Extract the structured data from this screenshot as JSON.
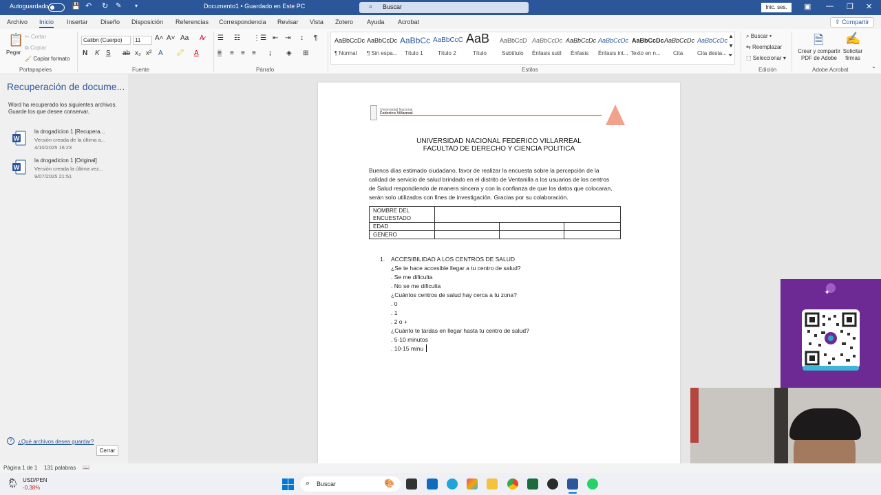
{
  "titlebar": {
    "autosave_label": "Autoguardado",
    "doc_title": "Documento1 • Guardado en Este PC",
    "search_placeholder": "Buscar",
    "signin_label": "Inic. ses."
  },
  "menu": {
    "tabs": [
      "Archivo",
      "Inicio",
      "Insertar",
      "Diseño",
      "Disposición",
      "Referencias",
      "Correspondencia",
      "Revisar",
      "Vista",
      "Zotero",
      "Ayuda",
      "Acrobat"
    ],
    "active_tab": "Inicio",
    "share_label": "Compartir"
  },
  "ribbon": {
    "clipboard": {
      "paste": "Pegar",
      "cut": "Cortar",
      "copy": "Copiar",
      "format_painter": "Copiar formato",
      "group": "Portapapeles"
    },
    "font": {
      "name": "Calibri (Cuerpo)",
      "size": "11",
      "group": "Fuente"
    },
    "paragraph": {
      "group": "Párrafo"
    },
    "styles": {
      "group": "Estilos",
      "items": [
        {
          "sample": "AaBbCcDc",
          "name": "¶ Normal"
        },
        {
          "sample": "AaBbCcDc",
          "name": "¶ Sin espa..."
        },
        {
          "sample": "AaBbCc",
          "name": "Título 1"
        },
        {
          "sample": "AaBbCcC",
          "name": "Título 2"
        },
        {
          "sample": "AaB",
          "name": "Título"
        },
        {
          "sample": "AaBbCcD",
          "name": "Subtítulo"
        },
        {
          "sample": "AaBbCcDc",
          "name": "Énfasis sutil"
        },
        {
          "sample": "AaBbCcDc",
          "name": "Énfasis"
        },
        {
          "sample": "AaBbCcDc",
          "name": "Énfasis int..."
        },
        {
          "sample": "AaBbCcDc",
          "name": "Texto en n..."
        },
        {
          "sample": "AaBbCcDc",
          "name": "Cita"
        },
        {
          "sample": "AaBbCcDc",
          "name": "Cita desta..."
        }
      ]
    },
    "editing": {
      "find": "Buscar",
      "replace": "Reemplazar",
      "select": "Seleccionar",
      "group": "Edición"
    },
    "acrobat": {
      "create": "Crear y compartir PDF de Adobe",
      "sign": "Solicitar firmas",
      "group": "Adobe Acrobat"
    }
  },
  "recovery": {
    "title": "Recuperación de docume...",
    "desc_line1": "Word ha recuperado los siguientes archivos.",
    "desc_line2": "Guarde los que desee conservar.",
    "files": [
      {
        "name": "la drogadicion 1 [Recupera...",
        "note": "Versión creada de la última a...",
        "date": "4/10/2025 16:23"
      },
      {
        "name": "la drogadicion 1 [Original]",
        "note": "Versión creada la última vez...",
        "date": "9/07/2025 21:51"
      }
    ],
    "help_link": "¿Qué archivos desea guardar?",
    "close_label": "Cerrar"
  },
  "document": {
    "logo_text1": "Universidad Nacional",
    "logo_text2": "Federico Villarreal",
    "heading1": "UNIVERSIDAD NACIONAL  FEDERICO VILLARREAL",
    "heading2": "FACULTAD DE DERECHO Y CIENCIA POLITICA",
    "intro": [
      "Buenos días estimado ciudadano, favor de realizar la encuesta sobre la percepción de la",
      "calidad de servicio de salud brindado en el distrito de Ventanilla a los usuarios de los centros",
      "de Salud respondiendo de manera sincera y con la confianza de que los datos que colocaran,",
      "serán solo utilizados con fines de investigación. Gracias por su colaboración."
    ],
    "table": {
      "name_label_1": "NOMBRE DEL",
      "name_label_2": "ENCUESTADO",
      "age_label": "EDAD",
      "gender_label": "GENERO"
    },
    "section_number": "1.",
    "section_title": "ACCESIBILIDAD A LOS CENTROS DE SALUD",
    "lines": [
      "¿Se te hace accesible llegar a tu centro de salud?",
      ". Se me dificulta",
      ". No se me dificulta",
      "¿Cuántos centros de salud hay cerca a tu zona?",
      ". 0",
      ". 1",
      ". 2 o +",
      "¿Cuánto te tardas en llegar hasta tu centro de salud?",
      ". 5-10 minutos",
      ". 10-15 minu"
    ]
  },
  "statusbar": {
    "page": "Página 1 de 1",
    "words": "131 palabras"
  },
  "taskbar": {
    "ticker_name": "USD/PEN",
    "ticker_change": "-0.38%",
    "search_placeholder": "Buscar"
  },
  "colors": {
    "word_blue": "#2b579a",
    "purple_panel": "#6d2a95"
  }
}
